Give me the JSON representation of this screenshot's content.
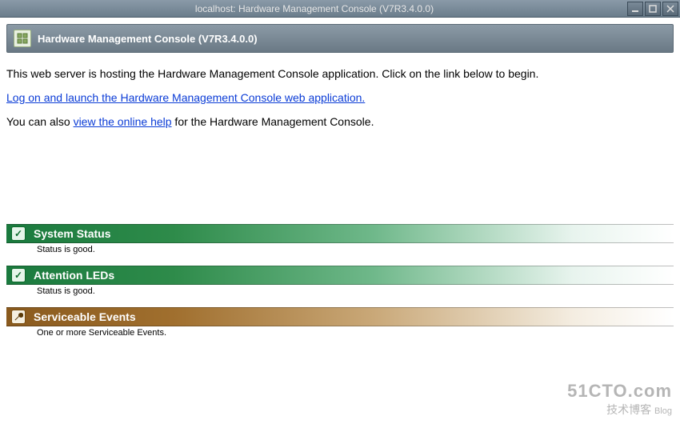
{
  "window": {
    "title": "localhost: Hardware Management Console (V7R3.4.0.0)"
  },
  "header": {
    "title": "Hardware Management Console (V7R3.4.0.0)",
    "icon": "servers-icon"
  },
  "intro_text": "This web server is hosting the Hardware Management Console application.  Click on the link below to begin.",
  "launch_link": "Log on and launch the Hardware Management Console web application.",
  "help_row": {
    "prefix": "You can also ",
    "link": "view the online help",
    "suffix": " for the Hardware Management Console."
  },
  "status_items": [
    {
      "title": "System Status",
      "subtitle": "Status is good.",
      "icon": "check-icon",
      "style": "green"
    },
    {
      "title": "Attention LEDs",
      "subtitle": "Status is good.",
      "icon": "check-icon",
      "style": "green"
    },
    {
      "title": "Serviceable Events",
      "subtitle": "One or more Serviceable Events.",
      "icon": "wrench-icon",
      "style": "brown"
    }
  ],
  "watermark": {
    "line1": "51CTO.com",
    "line2": "技术博客",
    "tag": "Blog"
  }
}
